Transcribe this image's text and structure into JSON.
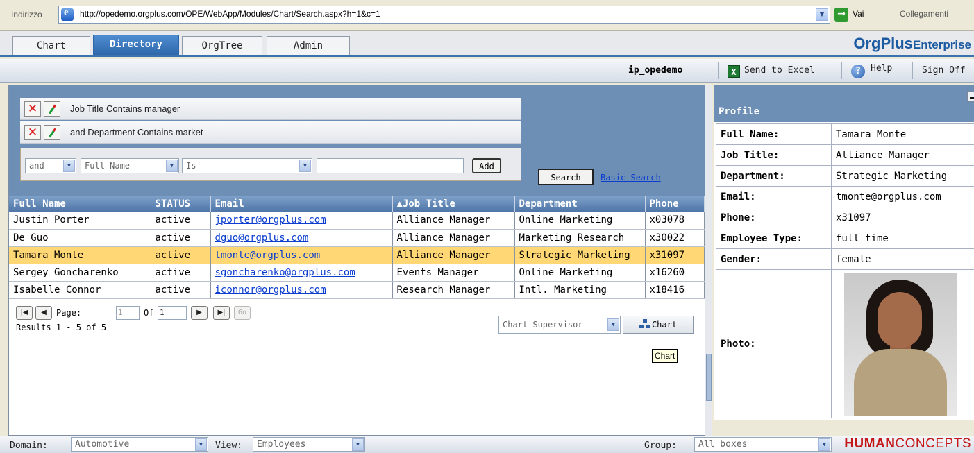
{
  "browser": {
    "address_label": "Indirizzo",
    "url": "http://opedemo.orgplus.com/OPE/WebApp/Modules/Chart/Search.aspx?h=1&c=1",
    "go_label": "Vai",
    "links_label": "Collegamenti"
  },
  "tabs": [
    {
      "label": "Chart"
    },
    {
      "label": "Directory",
      "active": true
    },
    {
      "label": "OrgTree"
    },
    {
      "label": "Admin"
    }
  ],
  "brand": {
    "name": "OrgPlus",
    "suffix": "Enterprise"
  },
  "toolbar": {
    "user": "ip_opedemo",
    "send_excel": "Send to Excel",
    "help": "Help",
    "sign_off": "Sign Off"
  },
  "search": {
    "criteria": [
      {
        "text": "Job Title Contains manager"
      },
      {
        "text": "and Department Contains market"
      }
    ],
    "add_row": {
      "connector": "and",
      "field": "Full Name",
      "operator": "Is",
      "value": "",
      "add_label": "Add"
    },
    "search_label": "Search",
    "basic_search_label": "Basic Search"
  },
  "table": {
    "columns": [
      "Full Name",
      "STATUS",
      "Email",
      "▲Job Title",
      "Department",
      "Phone"
    ],
    "rows": [
      {
        "name": "Justin Porter",
        "status": "active",
        "email": "jporter@orgplus.com",
        "title": "Alliance Manager",
        "dept": "Online Marketing",
        "phone": "x03078"
      },
      {
        "name": "De Guo",
        "status": "active",
        "email": "dguo@orgplus.com",
        "title": "Alliance Manager",
        "dept": "Marketing Research",
        "phone": "x30022"
      },
      {
        "name": "Tamara Monte",
        "status": "active",
        "email": "tmonte@orgplus.com",
        "title": "Alliance Manager",
        "dept": "Strategic Marketing",
        "phone": "x31097",
        "selected": true
      },
      {
        "name": "Sergey Goncharenko",
        "status": "active",
        "email": "sgoncharenko@orgplus.com",
        "title": "Events Manager",
        "dept": "Online Marketing",
        "phone": "x16260"
      },
      {
        "name": "Isabelle Connor",
        "status": "active",
        "email": "iconnor@orgplus.com",
        "title": "Research Manager",
        "dept": "Intl. Marketing",
        "phone": "x18416"
      }
    ]
  },
  "pager": {
    "page_label": "Page:",
    "page_value": "1",
    "of_label": "Of",
    "of_value": "1",
    "go_label": "Go",
    "results": "Results 1 - 5 of 5",
    "chart_by": "Chart Supervisor",
    "chart_label": "Chart",
    "tooltip": "Chart"
  },
  "profile": {
    "title": "Profile",
    "fields": [
      {
        "label": "Full Name:",
        "value": "Tamara Monte"
      },
      {
        "label": "Job Title:",
        "value": "Alliance Manager"
      },
      {
        "label": "Department:",
        "value": "Strategic Marketing"
      },
      {
        "label": "Email:",
        "value": "tmonte@orgplus.com"
      },
      {
        "label": "Phone:",
        "value": "x31097"
      },
      {
        "label": "Employee Type:",
        "value": "full time"
      },
      {
        "label": "Gender:",
        "value": "female"
      }
    ],
    "photo_label": "Photo:"
  },
  "bottom": {
    "domain_label": "Domain:",
    "domain_value": "Automotive",
    "view_label": "View:",
    "view_value": "Employees",
    "group_label": "Group:",
    "group_value": "All boxes",
    "logo_human": "HUMAN",
    "logo_concepts": "CONCEPTS"
  },
  "colors": {
    "accent": "#3b73ae",
    "selected_row": "#ffd875",
    "header_blue": "#6d8fb5",
    "link": "#0b3dcf",
    "logo_red": "#c41818"
  }
}
